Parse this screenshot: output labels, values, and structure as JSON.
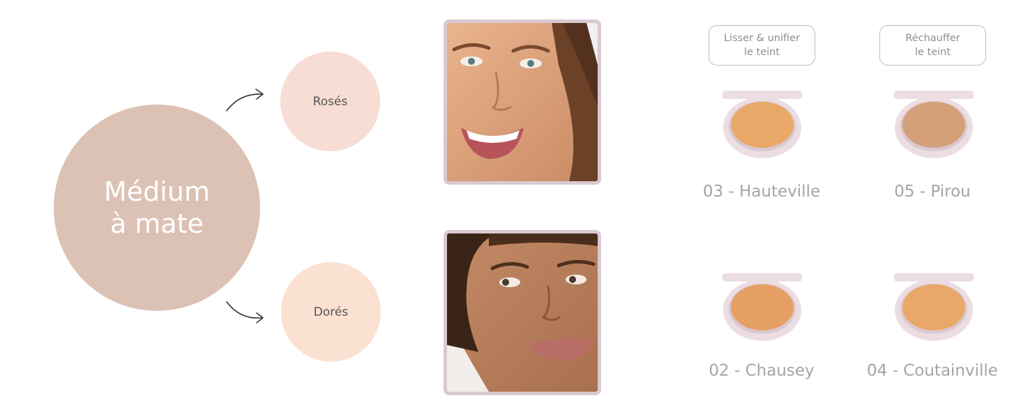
{
  "main_category": {
    "line1": "Médium",
    "line2": "à mate"
  },
  "undertones": [
    {
      "label": "Rosés",
      "color": "#f7ddd3"
    },
    {
      "label": "Dorés",
      "color": "#fbe1d1"
    }
  ],
  "benefit_tags": [
    {
      "line1": "Lisser & unifier",
      "line2": "le teint"
    },
    {
      "line1": "Réchauffer",
      "line2": "le teint"
    }
  ],
  "shades": [
    {
      "label": "03 - Hauteville",
      "pan_color": "#e9a867"
    },
    {
      "label": "05 - Pirou",
      "pan_color": "#d4a079"
    },
    {
      "label": "02 - Chausey",
      "pan_color": "#e6a063"
    },
    {
      "label": "04 - Coutainville",
      "pan_color": "#e9a768"
    }
  ],
  "colors": {
    "main_circle": "#dcc1b5",
    "frame_border": "#d9c9d1",
    "compact_case": "#ecdde3"
  },
  "icons": {
    "arrow_up": "curved-arrow-up-right-icon",
    "arrow_down": "curved-arrow-down-right-icon"
  },
  "photos": [
    {
      "name": "smiling-woman-photo"
    },
    {
      "name": "woman-looking-side-photo"
    }
  ]
}
